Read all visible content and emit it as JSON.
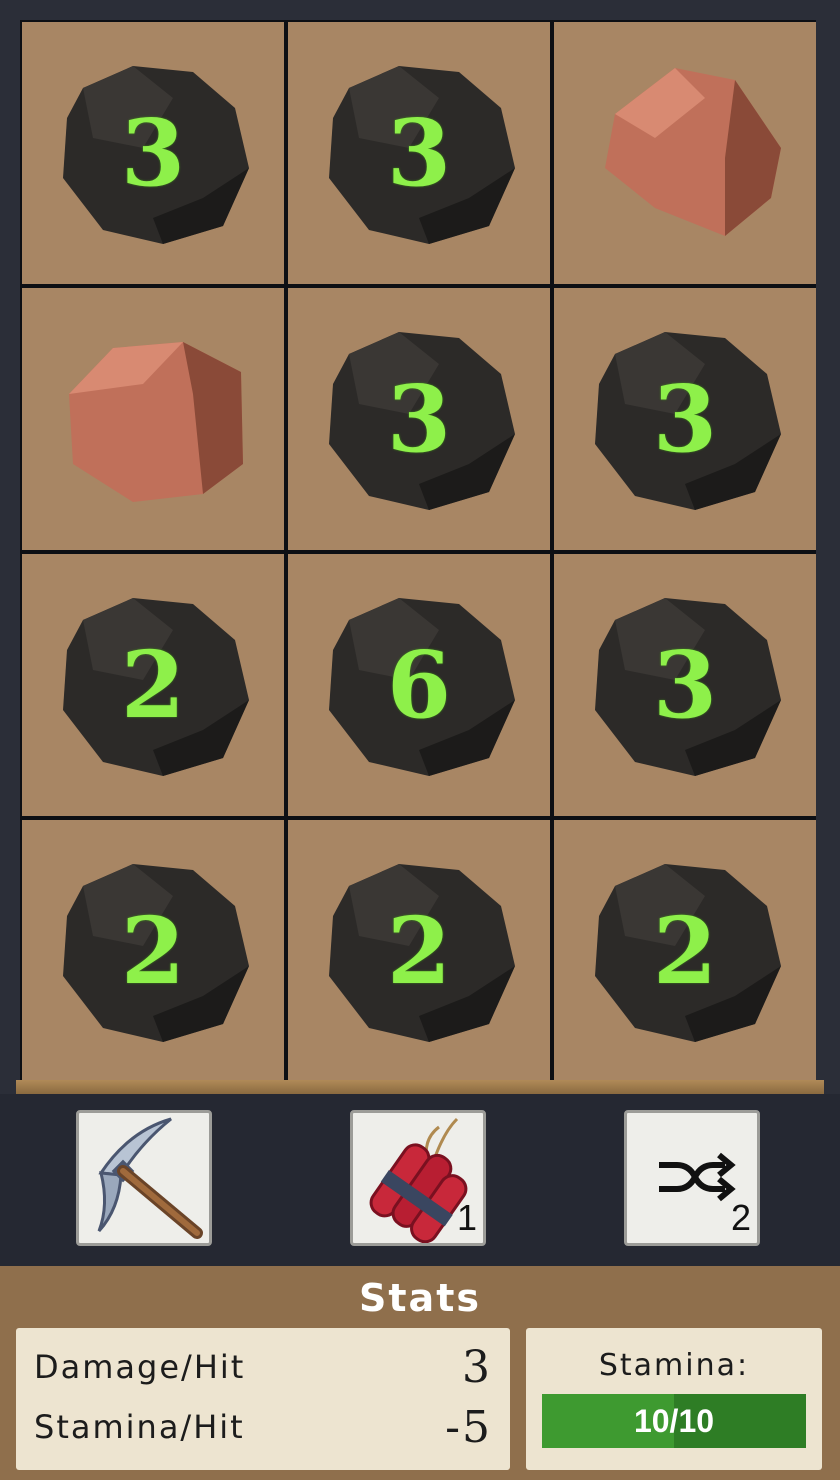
{
  "grid": [
    {
      "kind": "coal",
      "hits": "3"
    },
    {
      "kind": "coal",
      "hits": "3"
    },
    {
      "kind": "copper",
      "hits": ""
    },
    {
      "kind": "copper",
      "hits": ""
    },
    {
      "kind": "coal",
      "hits": "3"
    },
    {
      "kind": "coal",
      "hits": "3"
    },
    {
      "kind": "coal",
      "hits": "2"
    },
    {
      "kind": "coal",
      "hits": "6"
    },
    {
      "kind": "coal",
      "hits": "3"
    },
    {
      "kind": "coal",
      "hits": "2"
    },
    {
      "kind": "coal",
      "hits": "2"
    },
    {
      "kind": "coal",
      "hits": "2"
    }
  ],
  "toolbar": {
    "pickaxe": {
      "icon": "pickaxe-icon"
    },
    "dynamite": {
      "icon": "dynamite-icon",
      "count": "1"
    },
    "shuffle": {
      "icon": "shuffle-icon",
      "count": "2"
    }
  },
  "stats": {
    "title": "Stats",
    "damage_label": "Damage/Hit",
    "damage_value": "3",
    "stamina_cost_label": "Stamina/Hit",
    "stamina_cost_value": "-5",
    "stamina_label": "Stamina:",
    "stamina_text": "10/10",
    "stamina_fraction": 0.5
  },
  "colors": {
    "coal": "#2c2a28",
    "copper": "#c0705a",
    "digit": "#8ef04a",
    "tile": "#a88664"
  }
}
